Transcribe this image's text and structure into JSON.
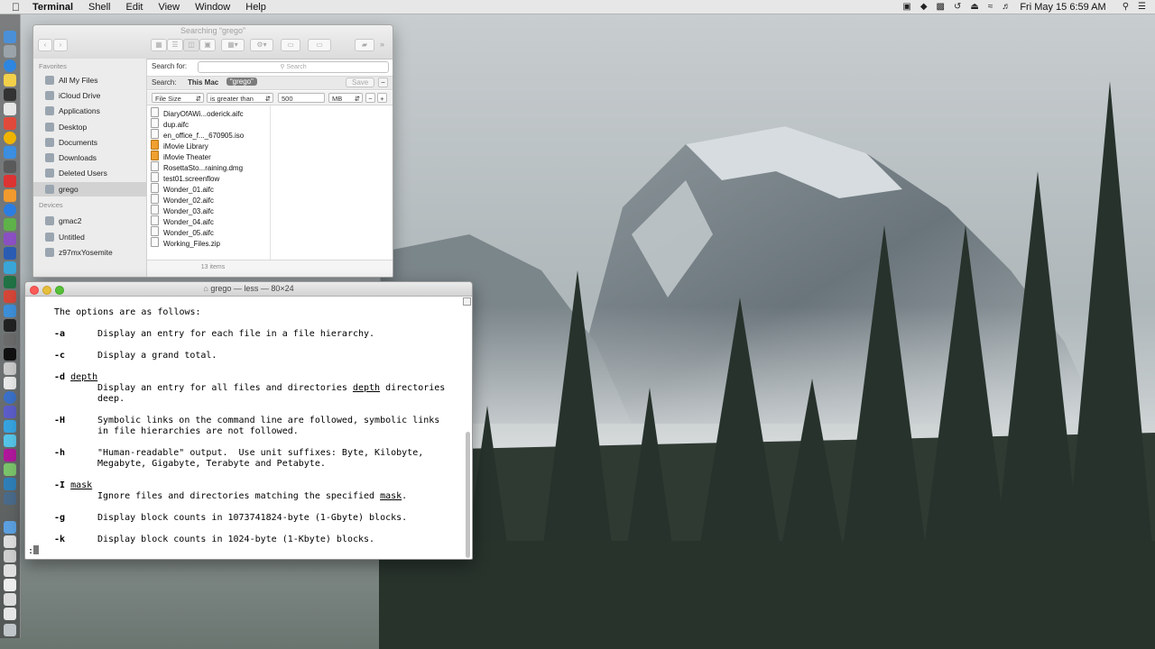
{
  "menubar": {
    "app": "Terminal",
    "items": [
      "Shell",
      "Edit",
      "View",
      "Window",
      "Help"
    ],
    "clock": "Fri May 15  6:59 AM"
  },
  "finder": {
    "title": "Searching “grego”",
    "search_label": "Search for:",
    "search_placeholder": "Search",
    "scope_label": "Search:",
    "scope_this_mac": "This Mac",
    "scope_user": "“grego”",
    "save_label": "Save",
    "criteria": {
      "attribute": "File Size",
      "operator": "is greater than",
      "value": "500",
      "unit": "MB"
    },
    "sidebar": {
      "favorites_head": "Favorites",
      "favorites": [
        "All My Files",
        "iCloud Drive",
        "Applications",
        "Desktop",
        "Documents",
        "Downloads",
        "Deleted Users",
        "grego"
      ],
      "devices_head": "Devices",
      "devices": [
        "gmac2",
        "Untitled",
        "z97mxYosemite"
      ]
    },
    "files": [
      "DiaryOfAWi...oderick.aifc",
      "dup.aifc",
      "en_office_f..._670905.iso",
      "iMovie Library",
      "iMovie Theater",
      "RosettaSto...raining.dmg",
      "test01.screenflow",
      "Wonder_01.aifc",
      "Wonder_02.aifc",
      "Wonder_03.aifc",
      "Wonder_04.aifc",
      "Wonder_05.aifc",
      "Working_Files.zip"
    ],
    "status": "13 items"
  },
  "terminal": {
    "title": "grego — less — 80×24",
    "intro": "The options are as follows:",
    "opt_a": "-a",
    "desc_a": "Display an entry for each file in a file hierarchy.",
    "opt_c": "-c",
    "desc_c": "Display a grand total.",
    "opt_d": "-d",
    "arg_d": "depth",
    "desc_d1_pre": "Display an entry for all files and directories ",
    "desc_d1_arg": "depth",
    "desc_d1_post": " directories",
    "desc_d2": "deep.",
    "opt_H": "-H",
    "desc_H1": "Symbolic links on the command line are followed, symbolic links",
    "desc_H2": "in file hierarchies are not followed.",
    "opt_h": "-h",
    "desc_h1": "\"Human-readable\" output.  Use unit suffixes: Byte, Kilobyte,",
    "desc_h2": "Megabyte, Gigabyte, Terabyte and Petabyte.",
    "opt_I": "-I",
    "arg_I": "mask",
    "desc_I_pre": "Ignore files and directories matching the specified ",
    "desc_I_arg": "mask",
    "desc_I_post": ".",
    "opt_g": "-g",
    "desc_g": "Display block counts in 1073741824-byte (1-Gbyte) blocks.",
    "opt_k": "-k",
    "desc_k": "Display block counts in 1024-byte (1-Kbyte) blocks.",
    "prompt": ":"
  },
  "colors": {
    "close": "#fc5b57",
    "minimize": "#e5bf3c",
    "zoom": "#57c038",
    "selection": "#d2d2d2"
  }
}
